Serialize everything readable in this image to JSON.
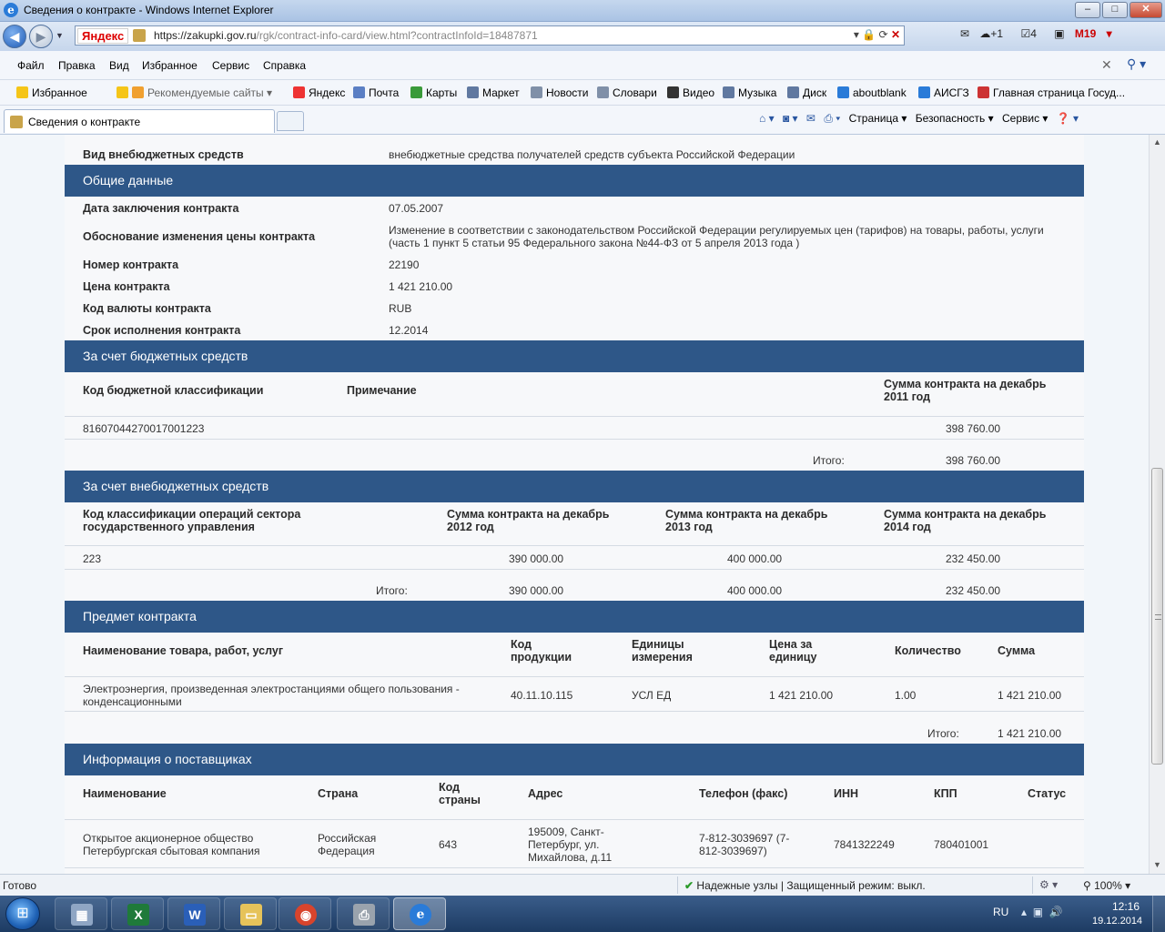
{
  "window": {
    "title": "Сведения о контракте - Windows Internet Explorer",
    "minimize": "–",
    "maximize": "□",
    "close": "✕"
  },
  "address": {
    "yandex_label": "Яндекс",
    "url_host": "https://zakupki.gov.ru",
    "url_path": "/rgk/contract-info-card/view.html?contractInfoId=18487871",
    "notif1": "+1",
    "notif2": "4",
    "mail_count": "19"
  },
  "menu": [
    "Файл",
    "Правка",
    "Вид",
    "Избранное",
    "Сервис",
    "Справка"
  ],
  "favorites": {
    "favorites_label": "Избранное",
    "recommended": "Рекомендуемые сайты ▾",
    "links": [
      "Яндекс",
      "Почта",
      "Карты",
      "Маркет",
      "Новости",
      "Словари",
      "Видео",
      "Музыка",
      "Диск",
      "aboutblank",
      "АИСГЗ",
      "Главная страница  Госуд..."
    ]
  },
  "tab": {
    "title": "Сведения о контракте"
  },
  "commandbar": {
    "page": "Страница ▾",
    "security": "Безопасность ▾",
    "service": "Сервис ▾"
  },
  "page": {
    "top_field": {
      "label": "Вид внебюджетных средств",
      "value": "внебюджетные средства получателей средств субъекта Российской Федерации"
    },
    "general": {
      "title": "Общие данные",
      "fields": [
        {
          "label": "Дата заключения контракта",
          "value": "07.05.2007"
        },
        {
          "label": "Обоснование изменения цены контракта",
          "value": "Изменение в соответствии с законодательством Российской Федерации регулируемых цен (тарифов) на товары, работы, услуги (часть 1 пункт 5 статьи 95 Федерального закона №44-ФЗ от 5 апреля 2013 года )"
        },
        {
          "label": "Номер контракта",
          "value": "22190"
        },
        {
          "label": "Цена контракта",
          "value": "1 421 210.00"
        },
        {
          "label": "Код валюты контракта",
          "value": "RUB"
        },
        {
          "label": "Срок исполнения контракта",
          "value": "12.2014"
        }
      ]
    },
    "budget": {
      "title": "За счет бюджетных средств",
      "headers": [
        "Код бюджетной классификации",
        "Примечание",
        "Сумма контракта на декабрь 2011 год"
      ],
      "row": [
        "81607044270017001223",
        "",
        "398 760.00"
      ],
      "total_label": "Итого:",
      "total": "398 760.00"
    },
    "extrabudget": {
      "title": "За счет внебюджетных средств",
      "headers": [
        "Код классификации операций сектора государственного управления",
        "Сумма контракта на декабрь 2012 год",
        "Сумма контракта на декабрь 2013 год",
        "Сумма контракта на декабрь 2014 год"
      ],
      "row": [
        "223",
        "390 000.00",
        "400 000.00",
        "232 450.00"
      ],
      "total_label": "Итого:",
      "totals": [
        "390 000.00",
        "400 000.00",
        "232 450.00"
      ]
    },
    "subject": {
      "title": "Предмет контракта",
      "headers": [
        "Наименование товара, работ, услуг",
        "Код продукции",
        "Единицы измерения",
        "Цена за единицу",
        "Количество",
        "Сумма"
      ],
      "row": [
        "Электроэнергия, произведенная электростанциями общего пользования - конденсационными",
        "40.11.10.115",
        "УСЛ ЕД",
        "1 421 210.00",
        "1.00",
        "1 421 210.00"
      ],
      "total_label": "Итого:",
      "total": "1 421 210.00"
    },
    "suppliers": {
      "title": "Информация о поставщиках",
      "headers": [
        "Наименование",
        "Страна",
        "Код страны",
        "Адрес",
        "Телефон (факс)",
        "ИНН",
        "КПП",
        "Статус"
      ],
      "row": [
        "Открытое акционерное общество Петербургская сбытовая компания",
        "Российская Федерация",
        "643",
        "195009, Санкт-Петербург, ул. Михайлова, д.11",
        "7-812-3039697 (7-812-3039697)",
        "7841322249",
        "780401001",
        ""
      ]
    }
  },
  "status": {
    "text": "Готово",
    "security": "Надежные узлы | Защищенный режим: выкл.",
    "zoom": "100%"
  },
  "taskbar": {
    "lang": "RU",
    "time": "12:16",
    "date": "19.12.2014"
  },
  "colors": {
    "section_header": "#2e5788",
    "content_bg": "#f7f8fa",
    "page_bg": "#f2f6fa"
  }
}
